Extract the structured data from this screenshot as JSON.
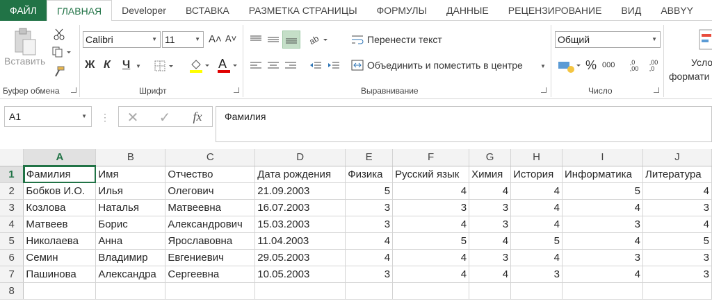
{
  "tabs": [
    "ФАЙЛ",
    "ГЛАВНАЯ",
    "Developer",
    "ВСТАВКА",
    "РАЗМЕТКА СТРАНИЦЫ",
    "ФОРМУЛЫ",
    "ДАННЫЕ",
    "РЕЦЕНЗИРОВАНИЕ",
    "ВИД",
    "ABBYY"
  ],
  "ribbon": {
    "paste_label": "Вставить",
    "clipboard_group": "Буфер обмена",
    "font_group": "Шрифт",
    "align_group": "Выравнивание",
    "number_group": "Число",
    "font_name": "Calibri",
    "font_size": "11",
    "grow_font": "A˄",
    "shrink_font": "A˅",
    "bold": "Ж",
    "italic": "К",
    "underline": "Ч",
    "wrap_text": "Перенести текст",
    "merge_center": "Объединить и поместить в центре",
    "number_format": "Общий",
    "percent": "%",
    "thousands": "000",
    "inc_decimal": ",0\n,00",
    "dec_decimal": ",00\n,0",
    "cond_format_1": "Усло",
    "cond_format_2": "формати"
  },
  "formula_bar": {
    "name_box": "A1",
    "fx": "fx",
    "content": "Фамилия"
  },
  "sheet": {
    "columns": [
      "A",
      "B",
      "C",
      "D",
      "E",
      "F",
      "G",
      "H",
      "I",
      "J"
    ],
    "rows": [
      {
        "n": "1",
        "cells": [
          "Фамилия",
          "Имя",
          "Отчество",
          "Дата рождения",
          "Физика",
          "Русский язык",
          "Химия",
          "История",
          "Информатика",
          "Литература"
        ]
      },
      {
        "n": "2",
        "cells": [
          "Бобков И.О.",
          "Илья",
          "Олегович",
          "21.09.2003",
          "5",
          "4",
          "4",
          "4",
          "5",
          "4"
        ]
      },
      {
        "n": "3",
        "cells": [
          "Козлова",
          "Наталья",
          "Матвеевна",
          "16.07.2003",
          "3",
          "3",
          "3",
          "4",
          "4",
          "3"
        ]
      },
      {
        "n": "4",
        "cells": [
          "Матвеев",
          "Борис",
          "Александрович",
          "15.03.2003",
          "3",
          "4",
          "3",
          "4",
          "3",
          "4"
        ]
      },
      {
        "n": "5",
        "cells": [
          "Николаева",
          "Анна",
          "Ярославовна",
          "11.04.2003",
          "4",
          "5",
          "4",
          "5",
          "4",
          "5"
        ]
      },
      {
        "n": "6",
        "cells": [
          "Семин",
          "Владимир",
          "Евгениевич",
          "29.05.2003",
          "4",
          "4",
          "3",
          "4",
          "3",
          "3"
        ]
      },
      {
        "n": "7",
        "cells": [
          "Пашинова",
          "Александра",
          "Сергеевна",
          "10.05.2003",
          "3",
          "4",
          "4",
          "3",
          "4",
          "3"
        ]
      },
      {
        "n": "8",
        "cells": [
          "",
          "",
          "",
          "",
          "",
          "",
          "",
          "",
          "",
          ""
        ]
      }
    ]
  }
}
